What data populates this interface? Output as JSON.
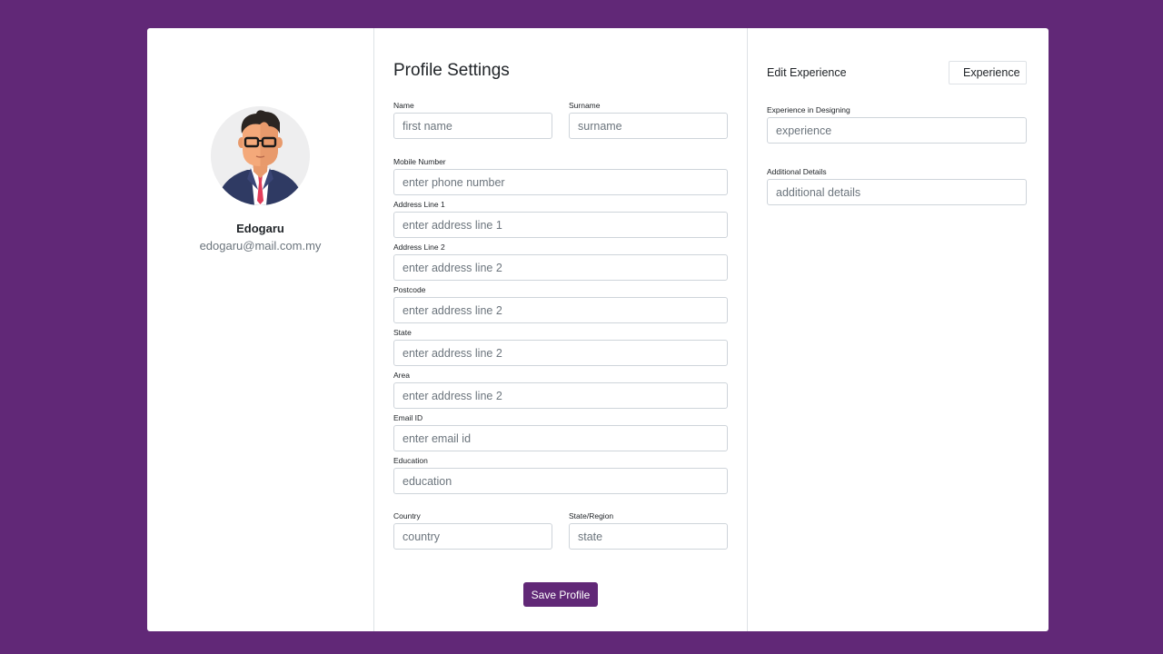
{
  "profile": {
    "name": "Edogaru",
    "email": "edogaru@mail.com.my",
    "avatar_icon": "user-avatar-icon"
  },
  "form": {
    "title": "Profile Settings",
    "name_label": "Name",
    "name_placeholder": "first name",
    "surname_label": "Surname",
    "surname_placeholder": "surname",
    "mobile_label": "Mobile Number",
    "mobile_placeholder": "enter phone number",
    "address1_label": "Address Line 1",
    "address1_placeholder": "enter address line 1",
    "address2_label": "Address Line 2",
    "address2_placeholder": "enter address line 2",
    "postcode_label": "Postcode",
    "postcode_placeholder": "enter address line 2",
    "state_label": "State",
    "state_placeholder": "enter address line 2",
    "area_label": "Area",
    "area_placeholder": "enter address line 2",
    "email_label": "Email ID",
    "email_placeholder": "enter email id",
    "education_label": "Education",
    "education_placeholder": "education",
    "country_label": "Country",
    "country_placeholder": "country",
    "region_label": "State/Region",
    "region_placeholder": "state",
    "save_label": "Save Profile"
  },
  "experience": {
    "title": "Edit Experience",
    "button_label": "Experience",
    "designing_label": "Experience in Designing",
    "designing_placeholder": "experience",
    "details_label": "Additional Details",
    "details_placeholder": "additional details"
  },
  "colors": {
    "background": "#612877",
    "primary_button": "#612877",
    "card": "#ffffff"
  }
}
